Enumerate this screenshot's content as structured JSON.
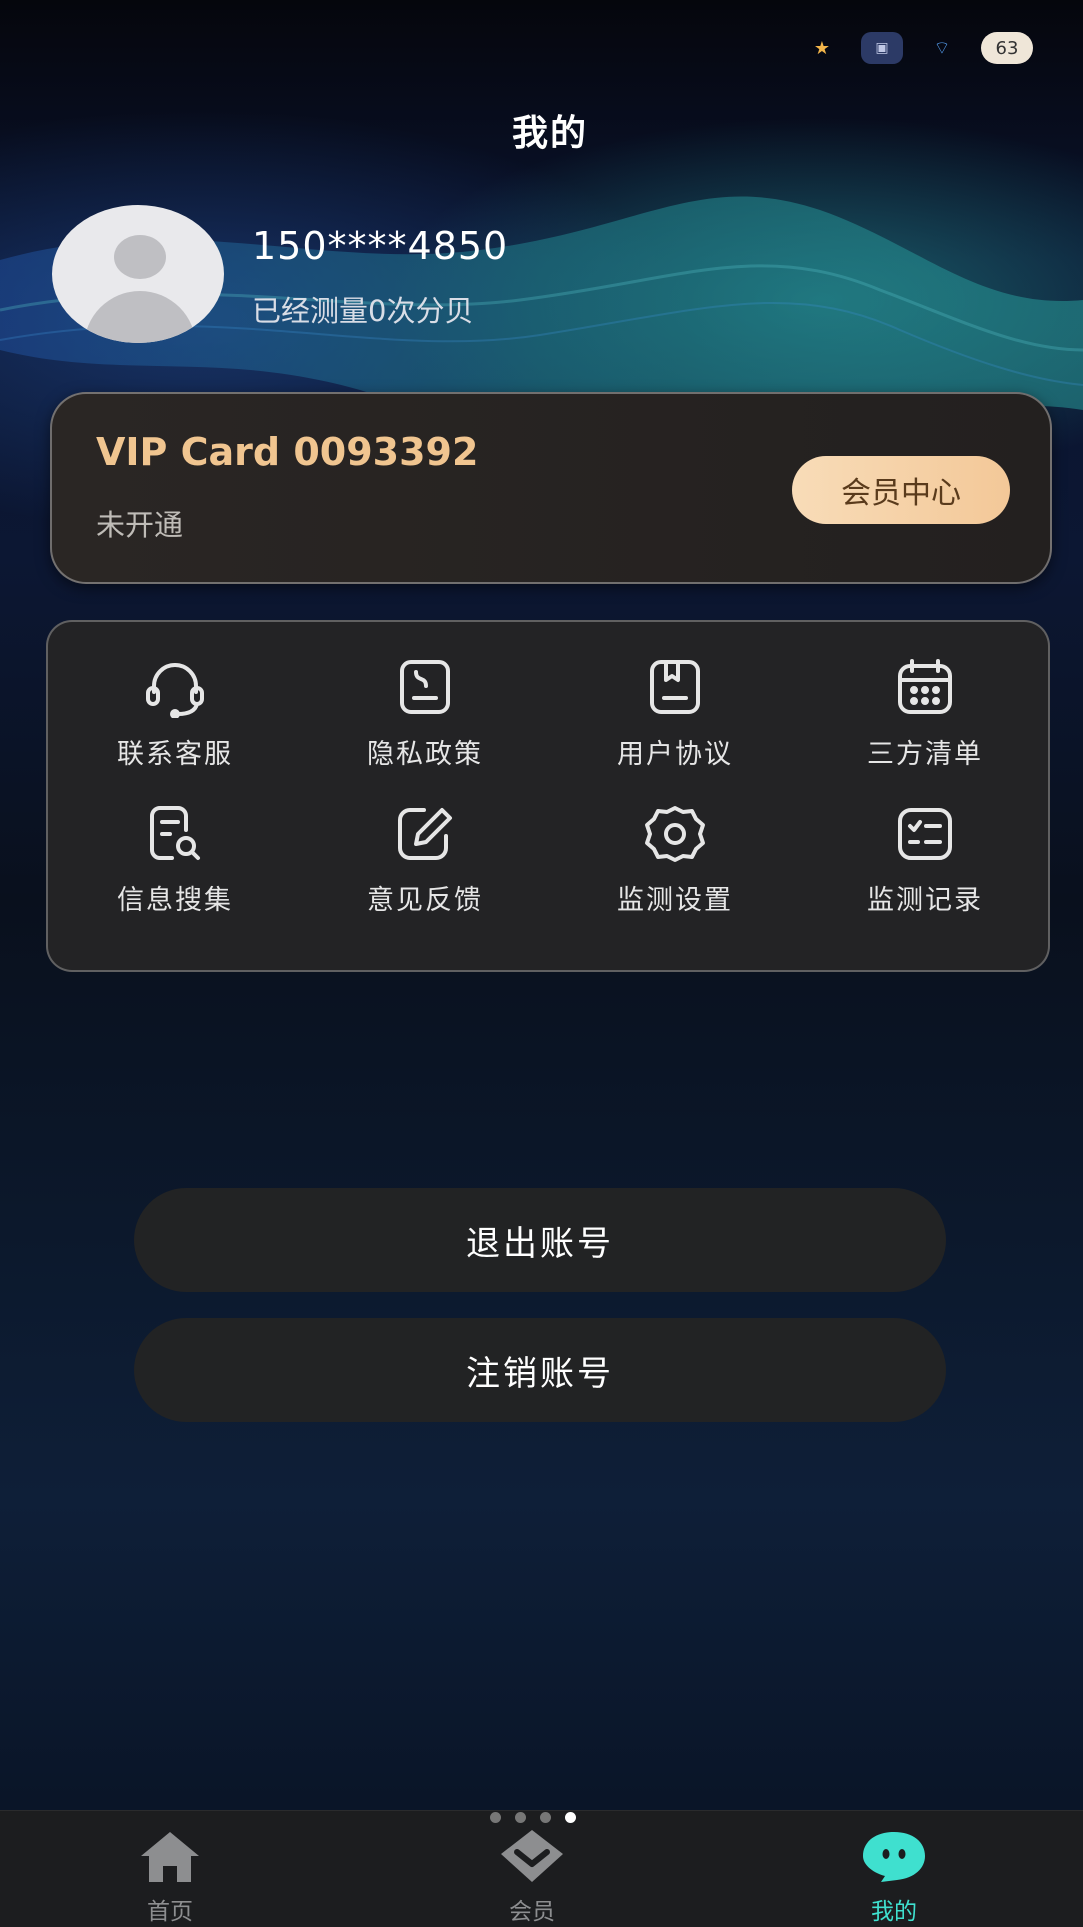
{
  "status_bar": {
    "icons": [
      "star-badge-icon",
      "sim-card-icon",
      "wifi-mascot-icon",
      "battery-icon"
    ],
    "battery_level": "63"
  },
  "header": {
    "title": "我的"
  },
  "profile": {
    "phone": "150****4850",
    "measure_text": "已经测量0次分贝"
  },
  "vip_card": {
    "title": "VIP Card 0093392",
    "status": "未开通",
    "button_label": "会员中心",
    "accent_color": "#f0c590"
  },
  "menu": {
    "items": [
      {
        "label": "联系客服",
        "icon": "headset-icon"
      },
      {
        "label": "隐私政策",
        "icon": "document-icon"
      },
      {
        "label": "用户协议",
        "icon": "agreement-icon"
      },
      {
        "label": "三方清单",
        "icon": "calendar-icon"
      },
      {
        "label": "信息搜集",
        "icon": "search-document-icon"
      },
      {
        "label": "意见反馈",
        "icon": "edit-icon"
      },
      {
        "label": "监测设置",
        "icon": "gear-icon"
      },
      {
        "label": "监测记录",
        "icon": "checklist-icon"
      }
    ]
  },
  "actions": {
    "logout_label": "退出账号",
    "delete_label": "注销账号"
  },
  "tabbar": {
    "page_indicator": {
      "count": 4,
      "active": 4
    },
    "tabs": [
      {
        "label": "首页",
        "icon": "home-icon"
      },
      {
        "label": "会员",
        "icon": "member-icon"
      },
      {
        "label": "我的",
        "icon": "chat-bubble-icon",
        "active": true
      }
    ],
    "active_color": "#3fe0cf"
  }
}
